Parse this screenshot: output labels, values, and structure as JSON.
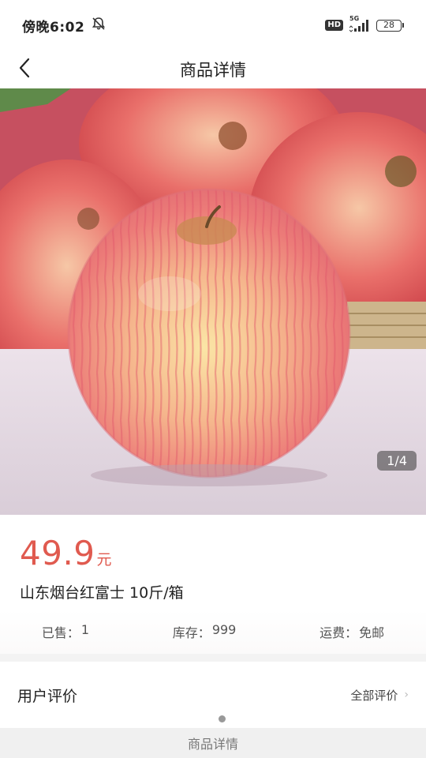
{
  "status_bar": {
    "time": "傍晚6:02",
    "hd_label": "HD",
    "network_label": "5G",
    "battery_level": "28",
    "icons": [
      "silent-bell-icon",
      "hd-icon",
      "signal-icon",
      "battery-icon"
    ]
  },
  "nav": {
    "title": "商品详情",
    "back_icon": "chevron-left-icon"
  },
  "gallery": {
    "page_indicator": "1/4"
  },
  "product": {
    "price": "49.9",
    "price_unit": "元",
    "title": "山东烟台红富士 10斤/箱",
    "price_color": "#e05a4f"
  },
  "stats": {
    "sold_label": "已售：",
    "sold_value": "1",
    "stock_label": "库存：",
    "stock_value": "999",
    "shipping_label": "运费：",
    "shipping_value": "免邮"
  },
  "reviews": {
    "title": "用户评价",
    "all_label": "全部评价",
    "chevron": "›"
  },
  "bottom": {
    "tab_label": "商品详情"
  }
}
